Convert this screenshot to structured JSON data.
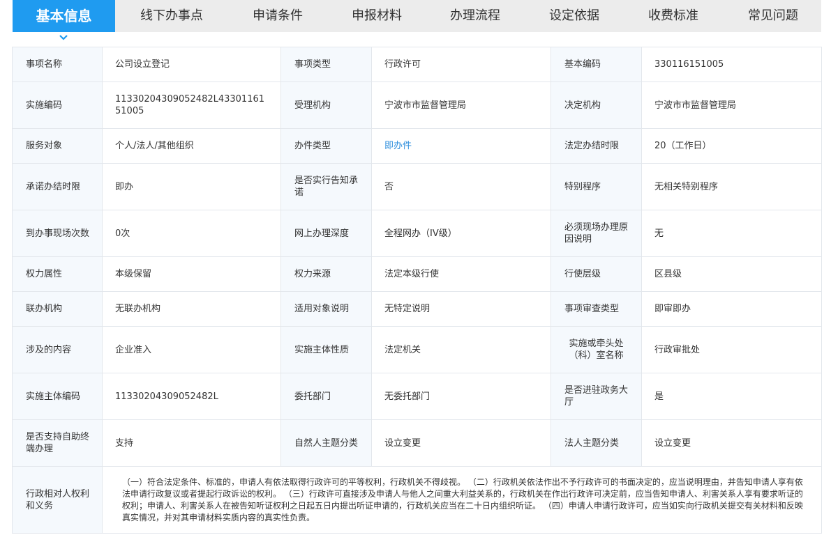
{
  "tabs": [
    {
      "label": "基本信息",
      "active": true
    },
    {
      "label": "线下办事点",
      "active": false
    },
    {
      "label": "申请条件",
      "active": false
    },
    {
      "label": "申报材料",
      "active": false
    },
    {
      "label": "办理流程",
      "active": false
    },
    {
      "label": "设定依据",
      "active": false
    },
    {
      "label": "收费标准",
      "active": false
    },
    {
      "label": "常见问题",
      "active": false
    }
  ],
  "rows": [
    [
      [
        "事项名称",
        "公司设立登记"
      ],
      [
        "事项类型",
        "行政许可"
      ],
      [
        "基本编码",
        "330116151005"
      ]
    ],
    [
      [
        "实施编码",
        "11330204309052482L4330116151005"
      ],
      [
        "受理机构",
        "宁波市市监督管理局"
      ],
      [
        "决定机构",
        "宁波市市监督管理局"
      ]
    ],
    [
      [
        "服务对象",
        "个人/法人/其他组织"
      ],
      [
        "办件类型",
        "即办件"
      ],
      [
        "法定办结时限",
        "20（工作日）"
      ]
    ],
    [
      [
        "承诺办结时限",
        "即办"
      ],
      [
        "是否实行告知承诺",
        "否"
      ],
      [
        "特别程序",
        "无相关特别程序"
      ]
    ],
    [
      [
        "到办事现场次数",
        "0次"
      ],
      [
        "网上办理深度",
        "全程网办（IV级）"
      ],
      [
        "必须现场办理原因说明",
        "无"
      ]
    ],
    [
      [
        "权力属性",
        "本级保留"
      ],
      [
        "权力来源",
        "法定本级行使"
      ],
      [
        "行使层级",
        "区县级"
      ]
    ],
    [
      [
        "联办机构",
        "无联办机构"
      ],
      [
        "适用对象说明",
        "无特定说明"
      ],
      [
        "事项审查类型",
        "即审即办"
      ]
    ],
    [
      [
        "涉及的内容",
        "企业准入"
      ],
      [
        "实施主体性质",
        "法定机关"
      ],
      [
        "实施或牵头处（科）室名称",
        "行政审批处"
      ]
    ],
    [
      [
        "实施主体编码",
        "11330204309052482L"
      ],
      [
        "委托部门",
        "无委托部门"
      ],
      [
        "是否进驻政务大厅",
        "是"
      ]
    ],
    [
      [
        "是否支持自助终端办理",
        "支持"
      ],
      [
        "自然人主题分类",
        "设立变更"
      ],
      [
        "法人主题分类",
        "设立变更"
      ]
    ]
  ],
  "rights": {
    "label": "行政相对人权利和义务",
    "text": "（一）符合法定条件、标准的，申请人有依法取得行政许可的平等权利，行政机关不得歧视。 （二）行政机关依法作出不予行政许可的书面决定的，应当说明理由，并告知申请人享有依法申请行政复议或者提起行政诉讼的权利。 （三）行政许可直接涉及申请人与他人之间重大利益关系的，行政机关在作出行政许可决定前，应当告知申请人、利害关系人享有要求听证的权利；申请人、利害关系人在被告知听证权利之日起五日内提出听证申请的，行政机关应当在二十日内组织听证。 （四）申请人申请行政许可，应当如实向行政机关提交有关材料和反映真实情况，并对其申请材料实质内容的真实性负责。"
  },
  "link_color": "#2f8fdd",
  "accent": "#1f9bf0"
}
